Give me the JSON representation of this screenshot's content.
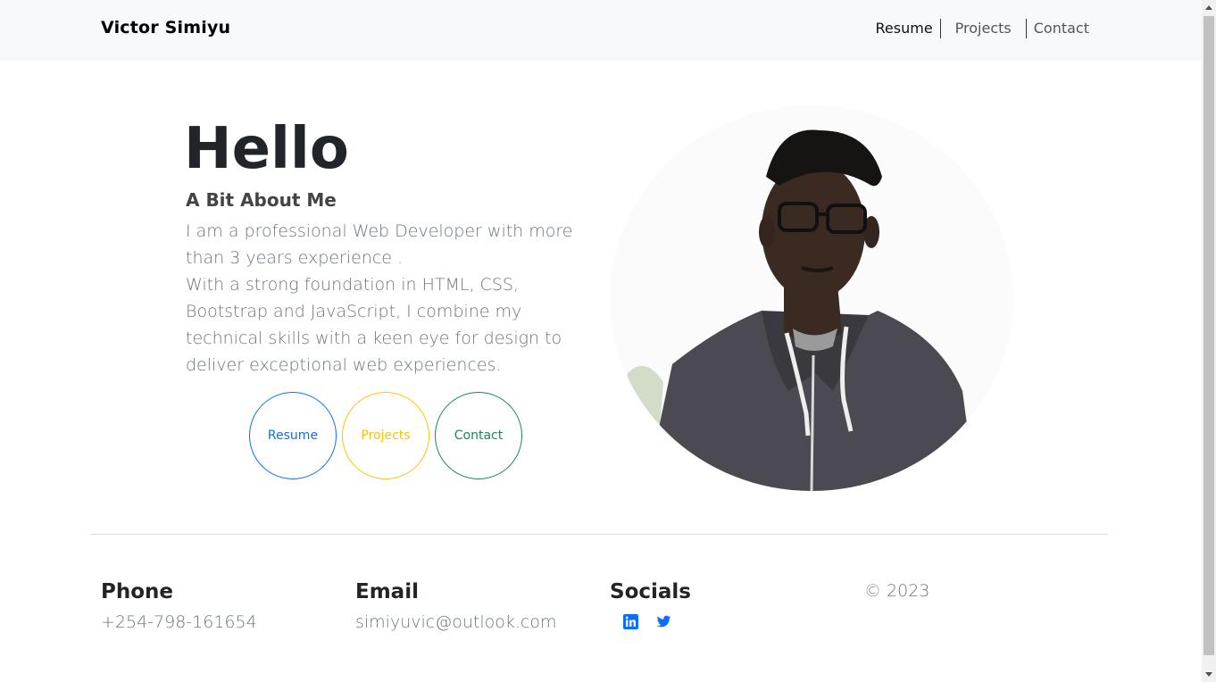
{
  "nav": {
    "brand": "Victor Simiyu",
    "links": [
      "Resume",
      "Projects",
      "Contact"
    ]
  },
  "hero": {
    "greeting": "Hello",
    "about_title": "A Bit About Me",
    "about_line1": "I am a professional Web Developer with more than 3 years experience .",
    "about_line2": "With a strong foundation in HTML, CSS, Bootstrap and JavaScript, I combine my technical skills with a keen eye for design to deliver exceptional web experiences.",
    "buttons": [
      "Resume",
      "Projects",
      "Contact"
    ]
  },
  "footer": {
    "phone_title": "Phone",
    "phone": "+254-798-161654",
    "email_title": "Email",
    "email": "simiyuvic@outlook.com",
    "socials_title": "Socials",
    "social_icons": [
      "linkedin-icon",
      "twitter-icon"
    ],
    "copyright": "© 2023"
  },
  "colors": {
    "primary": "#0d6efd",
    "warning": "#ffc107",
    "success": "#198754",
    "navbar_bg": "#f8f9fa"
  }
}
